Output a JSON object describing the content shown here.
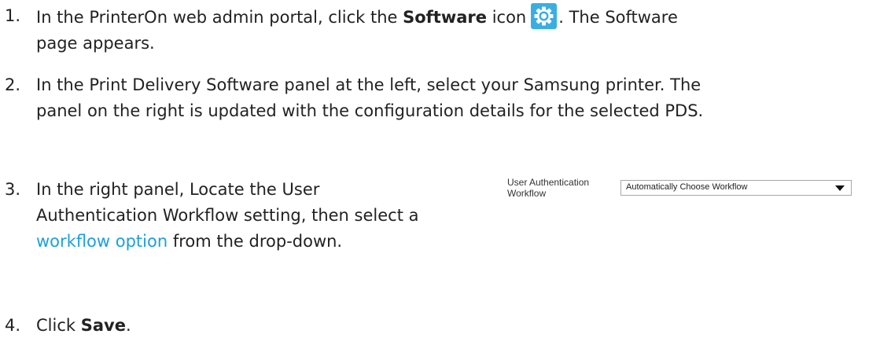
{
  "steps": [
    {
      "number": "1.",
      "line1_before": "In the PrinterOn web admin portal, click the ",
      "line1_bold": "Software",
      "line1_mid": " icon",
      "line1_after": ". The Software",
      "line2": "page appears.",
      "icon": "gear-icon"
    },
    {
      "number": "2.",
      "line1": "In the Print Delivery Software panel at the left, select your Samsung printer. The",
      "line2": "panel on the right is updated with the configuration details for the selected PDS."
    },
    {
      "number": "3.",
      "line1": "In the right panel, Locate the User",
      "line2": "Authentication Workflow setting, then select a",
      "line3_link": "workflow option",
      "line3_after": " from the drop-down."
    },
    {
      "number": "4.",
      "before": "Click ",
      "bold": "Save",
      "after": "."
    }
  ],
  "mini_form": {
    "label": "User Authentication\nWorkflow",
    "select_value": "Automatically Choose Workflow"
  },
  "colors": {
    "link": "#1ea0d9",
    "gear_icon": "#3aaee2",
    "text": "#222222"
  }
}
